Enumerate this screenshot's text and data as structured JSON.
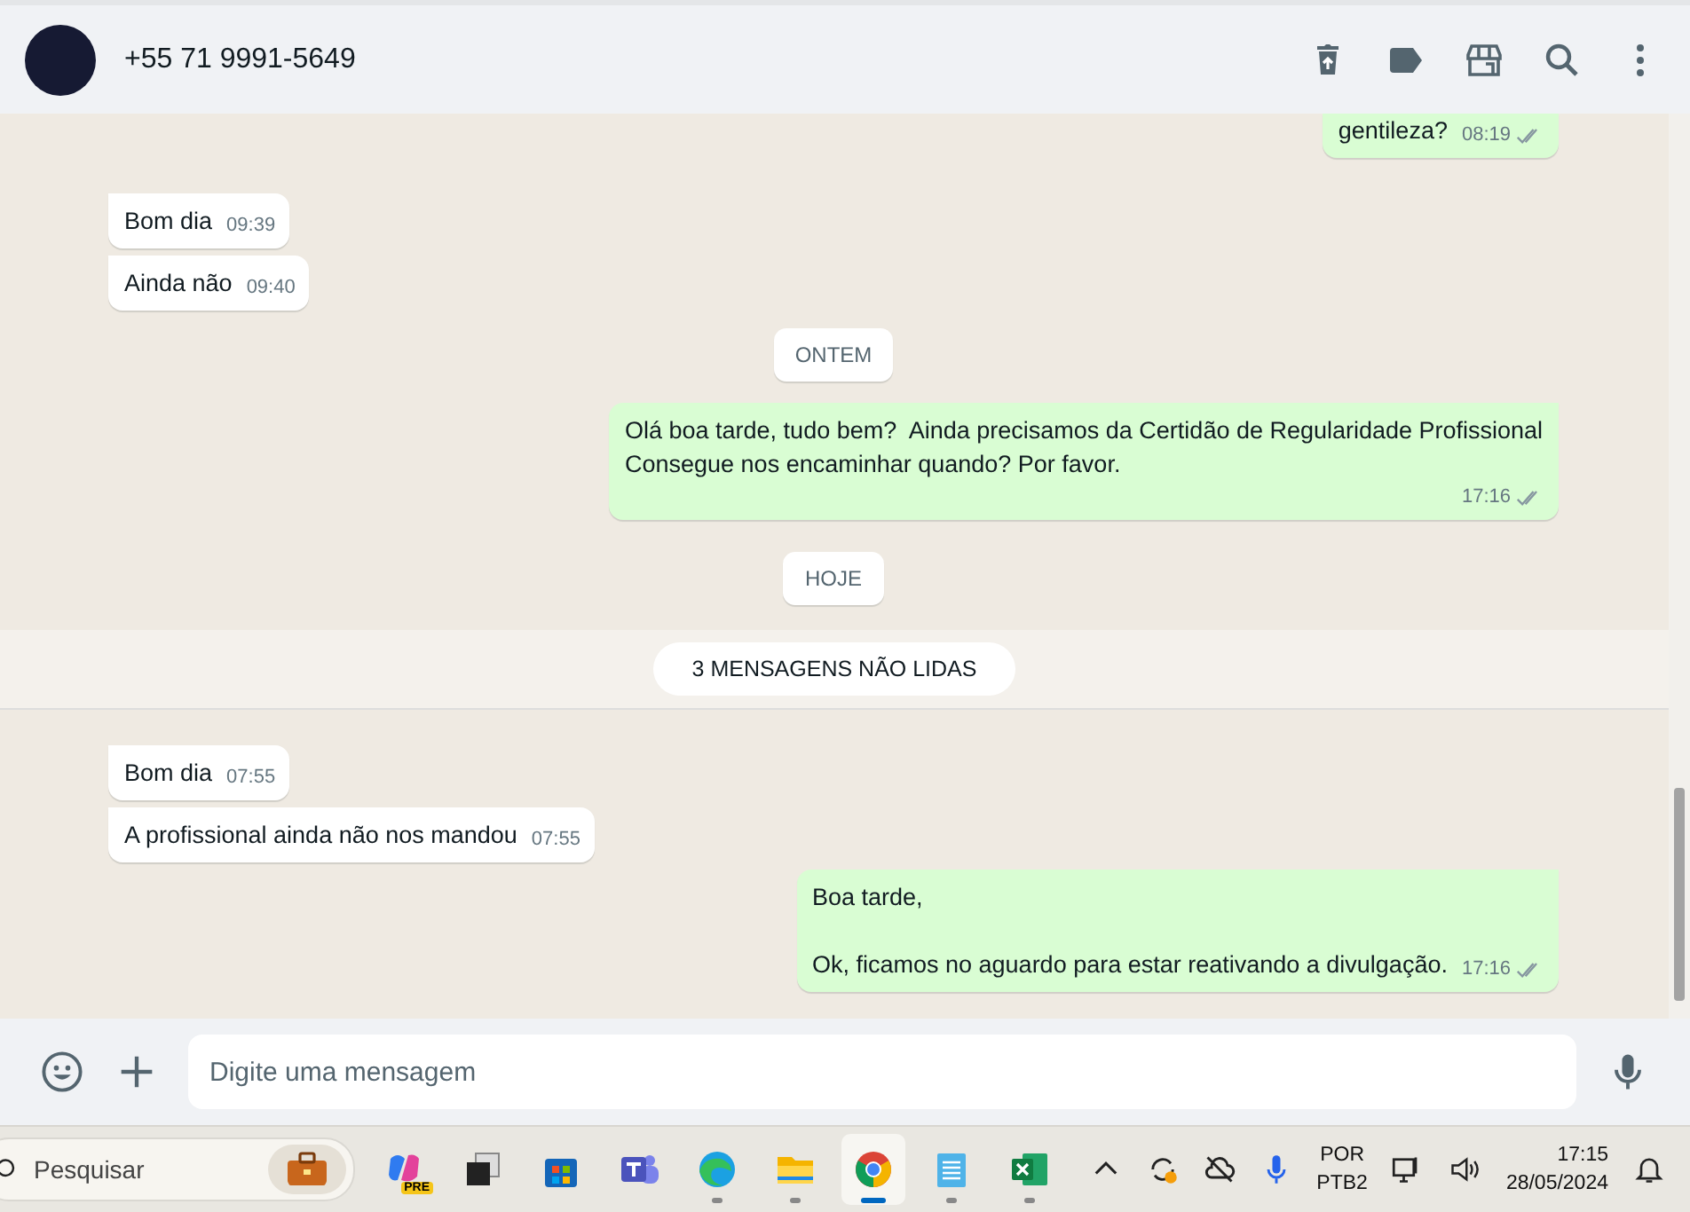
{
  "header": {
    "contact": "+55 71 9991-5649"
  },
  "messages": [
    {
      "kind": "out",
      "text": "gentileza?",
      "time": "08:19"
    },
    {
      "kind": "in",
      "text": "Bom dia",
      "time": "09:39"
    },
    {
      "kind": "in",
      "text": "Ainda não",
      "time": "09:40"
    },
    {
      "kind": "date",
      "text": "ONTEM"
    },
    {
      "kind": "out",
      "text": "Olá boa tarde, tudo bem?  Ainda precisamos da Certidão de Regularidade Profissional\nConsegue nos encaminhar quando? Por favor.",
      "time": "17:16"
    },
    {
      "kind": "date",
      "text": "HOJE"
    },
    {
      "kind": "unread",
      "text": "3 MENSAGENS NÃO LIDAS"
    },
    {
      "kind": "in",
      "text": "Bom dia",
      "time": "07:55"
    },
    {
      "kind": "in",
      "text": "A profissional ainda não nos mandou",
      "time": "07:55"
    },
    {
      "kind": "out",
      "text": "Boa tarde,\n\nOk, ficamos no aguardo para estar reativando a divulgação.",
      "time": "17:16"
    }
  ],
  "composer": {
    "placeholder": "Digite uma mensagem"
  },
  "taskbar": {
    "search": {
      "placeholder": "Pesquisar"
    },
    "apps": [
      {
        "kind": "copilot",
        "badge": "PRE",
        "running": false,
        "selected": false
      },
      {
        "kind": "taskview",
        "running": false,
        "selected": false
      },
      {
        "kind": "store",
        "running": false,
        "selected": false
      },
      {
        "kind": "teams",
        "running": false,
        "selected": false
      },
      {
        "kind": "edge",
        "running": true,
        "selected": false
      },
      {
        "kind": "files",
        "running": true,
        "selected": false
      },
      {
        "kind": "chrome",
        "running": true,
        "selected": true
      },
      {
        "kind": "notepad",
        "running": true,
        "selected": false
      },
      {
        "kind": "excel",
        "running": true,
        "selected": false
      }
    ],
    "language": [
      "POR",
      "PTB2"
    ],
    "time": "17:15",
    "date": "28/05/2024"
  }
}
